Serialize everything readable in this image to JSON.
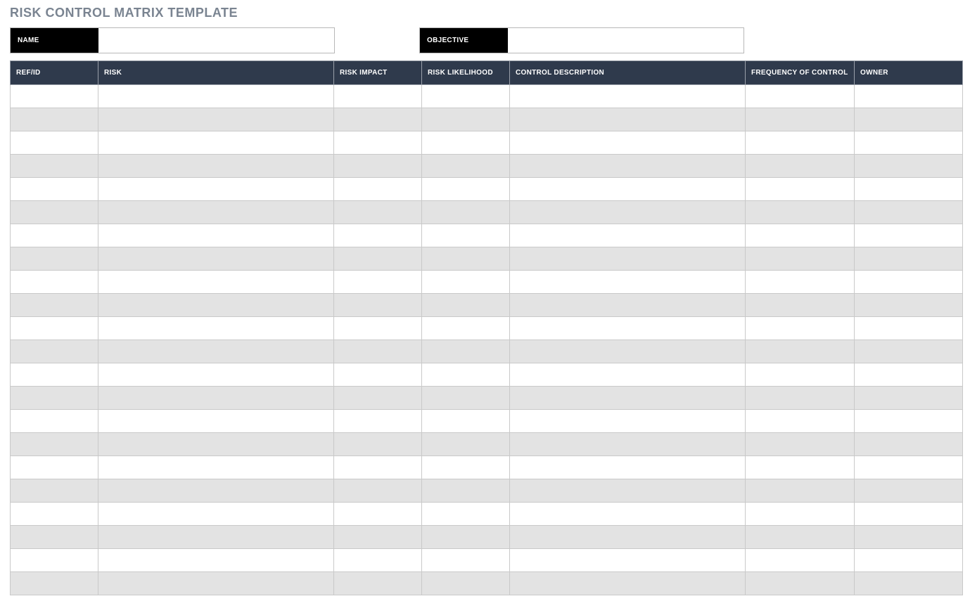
{
  "title": "RISK CONTROL MATRIX TEMPLATE",
  "meta": {
    "name_label": "NAME",
    "name_value": "",
    "objective_label": "OBJECTIVE",
    "objective_value": ""
  },
  "columns": {
    "ref": "REF/ID",
    "risk": "RISK",
    "impact": "RISK IMPACT",
    "likelihood": "RISK LIKELIHOOD",
    "control": "CONTROL DESCRIPTION",
    "frequency": "FREQUENCY OF CONTROL",
    "owner": "OWNER"
  },
  "rows": [
    {
      "ref": "",
      "risk": "",
      "impact": "",
      "likelihood": "",
      "control": "",
      "frequency": "",
      "owner": ""
    },
    {
      "ref": "",
      "risk": "",
      "impact": "",
      "likelihood": "",
      "control": "",
      "frequency": "",
      "owner": ""
    },
    {
      "ref": "",
      "risk": "",
      "impact": "",
      "likelihood": "",
      "control": "",
      "frequency": "",
      "owner": ""
    },
    {
      "ref": "",
      "risk": "",
      "impact": "",
      "likelihood": "",
      "control": "",
      "frequency": "",
      "owner": ""
    },
    {
      "ref": "",
      "risk": "",
      "impact": "",
      "likelihood": "",
      "control": "",
      "frequency": "",
      "owner": ""
    },
    {
      "ref": "",
      "risk": "",
      "impact": "",
      "likelihood": "",
      "control": "",
      "frequency": "",
      "owner": ""
    },
    {
      "ref": "",
      "risk": "",
      "impact": "",
      "likelihood": "",
      "control": "",
      "frequency": "",
      "owner": ""
    },
    {
      "ref": "",
      "risk": "",
      "impact": "",
      "likelihood": "",
      "control": "",
      "frequency": "",
      "owner": ""
    },
    {
      "ref": "",
      "risk": "",
      "impact": "",
      "likelihood": "",
      "control": "",
      "frequency": "",
      "owner": ""
    },
    {
      "ref": "",
      "risk": "",
      "impact": "",
      "likelihood": "",
      "control": "",
      "frequency": "",
      "owner": ""
    },
    {
      "ref": "",
      "risk": "",
      "impact": "",
      "likelihood": "",
      "control": "",
      "frequency": "",
      "owner": ""
    },
    {
      "ref": "",
      "risk": "",
      "impact": "",
      "likelihood": "",
      "control": "",
      "frequency": "",
      "owner": ""
    },
    {
      "ref": "",
      "risk": "",
      "impact": "",
      "likelihood": "",
      "control": "",
      "frequency": "",
      "owner": ""
    },
    {
      "ref": "",
      "risk": "",
      "impact": "",
      "likelihood": "",
      "control": "",
      "frequency": "",
      "owner": ""
    },
    {
      "ref": "",
      "risk": "",
      "impact": "",
      "likelihood": "",
      "control": "",
      "frequency": "",
      "owner": ""
    },
    {
      "ref": "",
      "risk": "",
      "impact": "",
      "likelihood": "",
      "control": "",
      "frequency": "",
      "owner": ""
    },
    {
      "ref": "",
      "risk": "",
      "impact": "",
      "likelihood": "",
      "control": "",
      "frequency": "",
      "owner": ""
    },
    {
      "ref": "",
      "risk": "",
      "impact": "",
      "likelihood": "",
      "control": "",
      "frequency": "",
      "owner": ""
    },
    {
      "ref": "",
      "risk": "",
      "impact": "",
      "likelihood": "",
      "control": "",
      "frequency": "",
      "owner": ""
    },
    {
      "ref": "",
      "risk": "",
      "impact": "",
      "likelihood": "",
      "control": "",
      "frequency": "",
      "owner": ""
    },
    {
      "ref": "",
      "risk": "",
      "impact": "",
      "likelihood": "",
      "control": "",
      "frequency": "",
      "owner": ""
    },
    {
      "ref": "",
      "risk": "",
      "impact": "",
      "likelihood": "",
      "control": "",
      "frequency": "",
      "owner": ""
    }
  ]
}
